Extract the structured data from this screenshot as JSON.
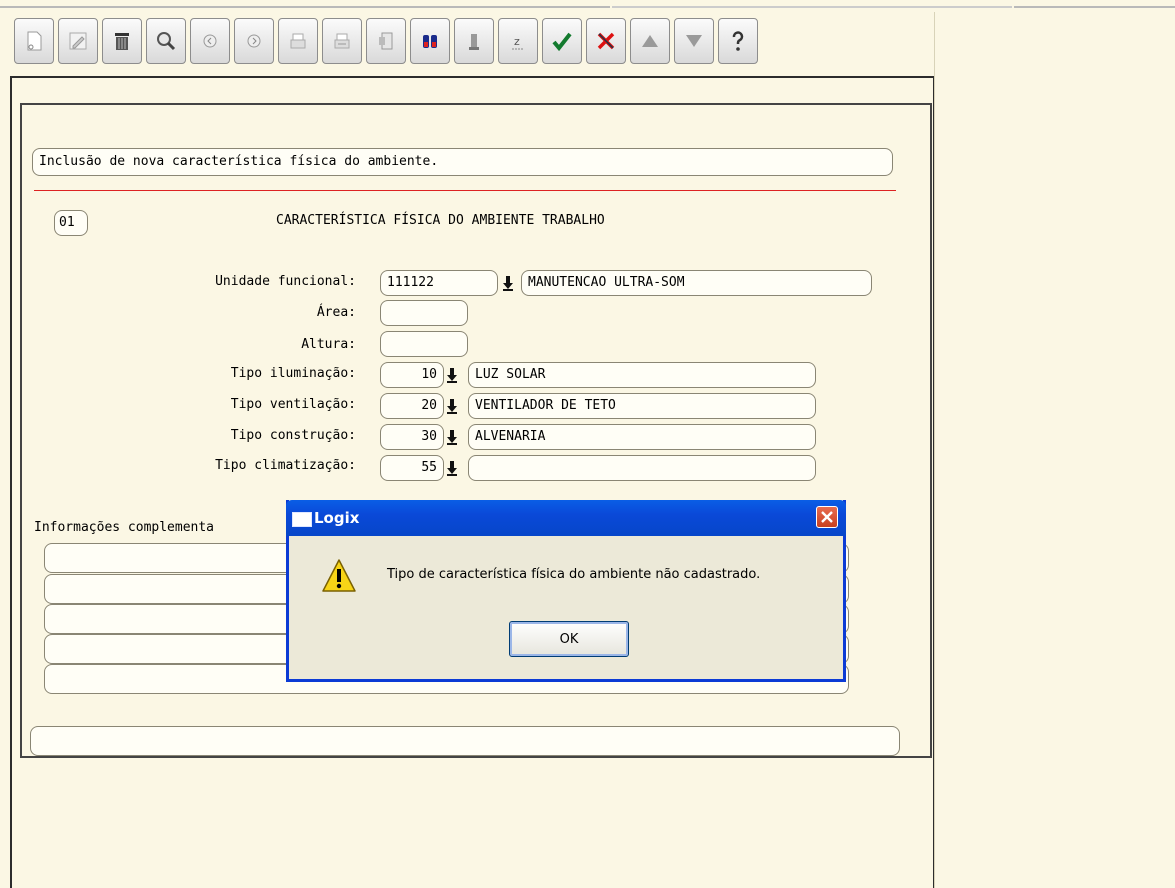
{
  "form": {
    "status_message": "Inclusão de nova característica física do ambiente.",
    "record_number": "01",
    "section_title": "CARACTERÍSTICA FÍSICA DO AMBIENTE TRABALHO",
    "fields": {
      "unidade_label": "Unidade funcional:",
      "unidade_code": "111122",
      "unidade_desc": "MANUTENCAO ULTRA-SOM",
      "area_label": "Área:",
      "area_value": "",
      "altura_label": "Altura:",
      "altura_value": "",
      "iluminacao_label": "Tipo iluminação:",
      "iluminacao_code": "10",
      "iluminacao_desc": "LUZ SOLAR",
      "ventilacao_label": "Tipo ventilação:",
      "ventilacao_code": "20",
      "ventilacao_desc": "VENTILADOR DE TETO",
      "construcao_label": "Tipo construção:",
      "construcao_code": "30",
      "construcao_desc": "ALVENARIA",
      "climatizacao_label": "Tipo climatização:",
      "climatizacao_code": "55",
      "climatizacao_desc": ""
    },
    "complementary_label": "Informações complementa",
    "complementary_lines": [
      "",
      "",
      "",
      "",
      ""
    ],
    "bottom_status": ""
  },
  "toolbar": {
    "buttons": [
      "new-icon",
      "edit-icon",
      "delete-icon",
      "search-icon",
      "previous-icon",
      "next-icon",
      "print-icon",
      "print-preview-icon",
      "export-icon",
      "binoculars-icon",
      "info-icon",
      "summary-icon",
      "confirm-icon",
      "cancel-icon",
      "first-icon",
      "last-icon",
      "help-icon"
    ]
  },
  "dialog": {
    "title": "Logix",
    "message": "Tipo de característica física do ambiente não cadastrado.",
    "ok_label": "OK"
  }
}
